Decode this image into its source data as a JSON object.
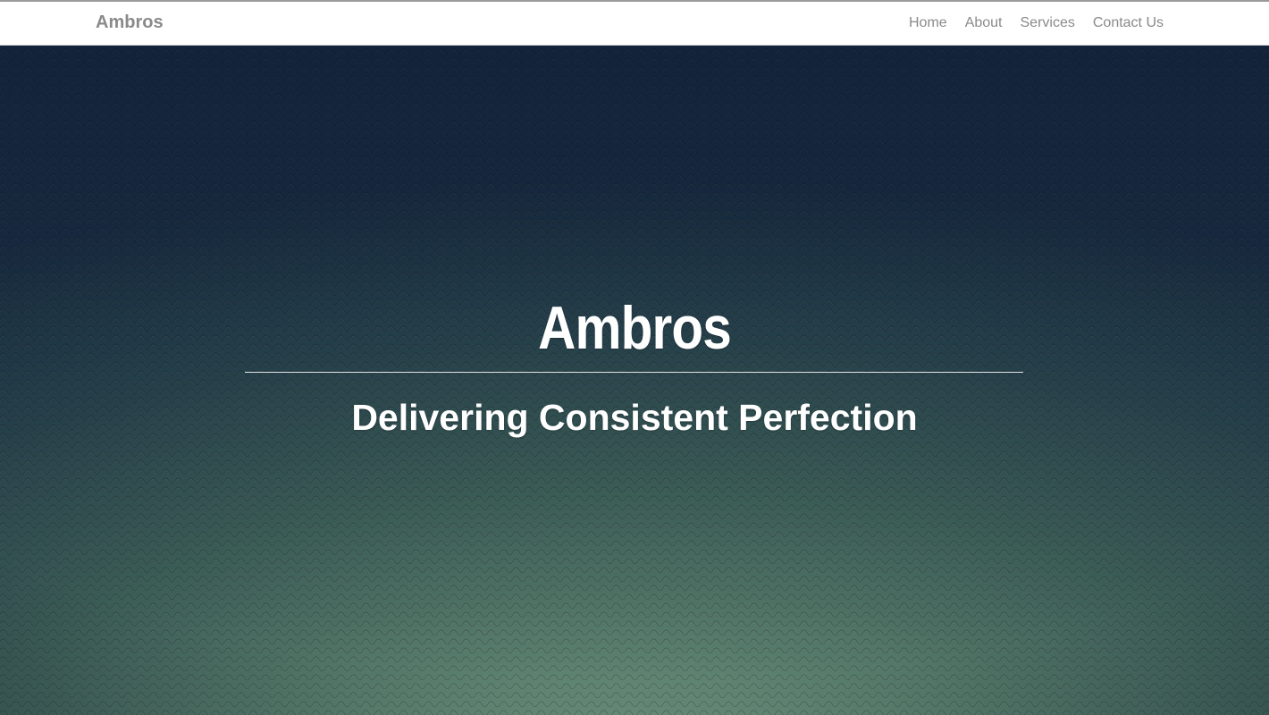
{
  "navbar": {
    "brand": "Ambros",
    "links": [
      "Home",
      "About",
      "Services",
      "Contact Us"
    ]
  },
  "hero": {
    "title": "Ambros",
    "subtitle": "Delivering Consistent Perfection"
  },
  "colors": {
    "nav_text": "#8a8a8a",
    "hero_top": "#172a3e",
    "hero_bottom": "#7aa48a",
    "hero_text": "#ffffff"
  }
}
